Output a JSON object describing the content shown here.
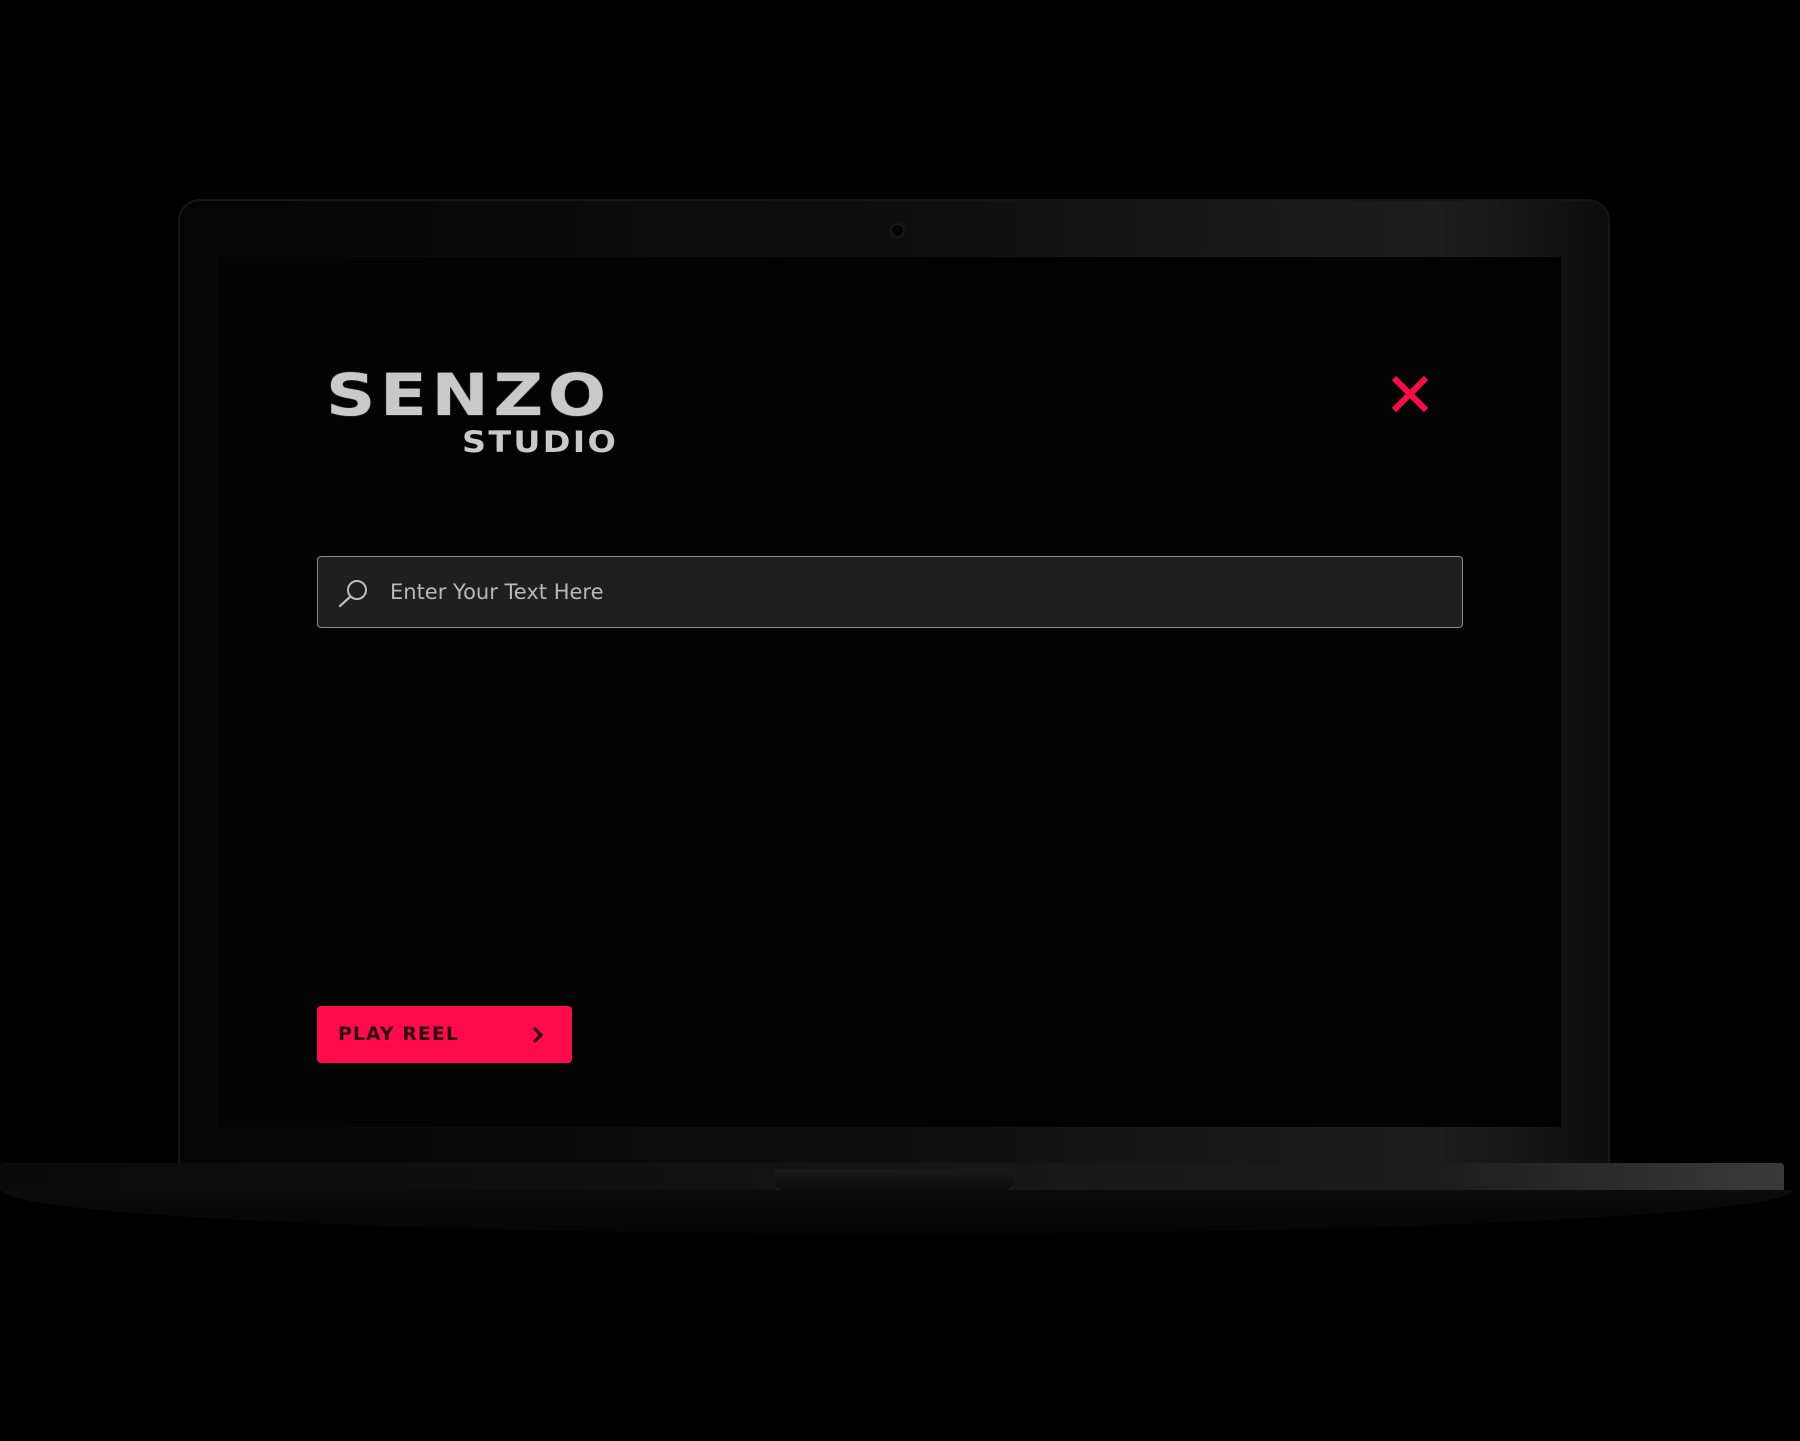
{
  "brand": {
    "name": "SENZO",
    "subtitle": "STUDIO"
  },
  "search": {
    "placeholder": "Enter Your Text Here",
    "value": ""
  },
  "actions": {
    "play_reel_label": "PLAY REEL",
    "close_icon": "close-icon",
    "arrow_icon": "chevron-right-icon",
    "search_icon": "search-icon"
  },
  "colors": {
    "accent": "#ff0a4b",
    "background": "#030303",
    "logo": "#c9c9c9",
    "search_bg": "#1f1f1f",
    "search_border": "#8a8a8a"
  }
}
